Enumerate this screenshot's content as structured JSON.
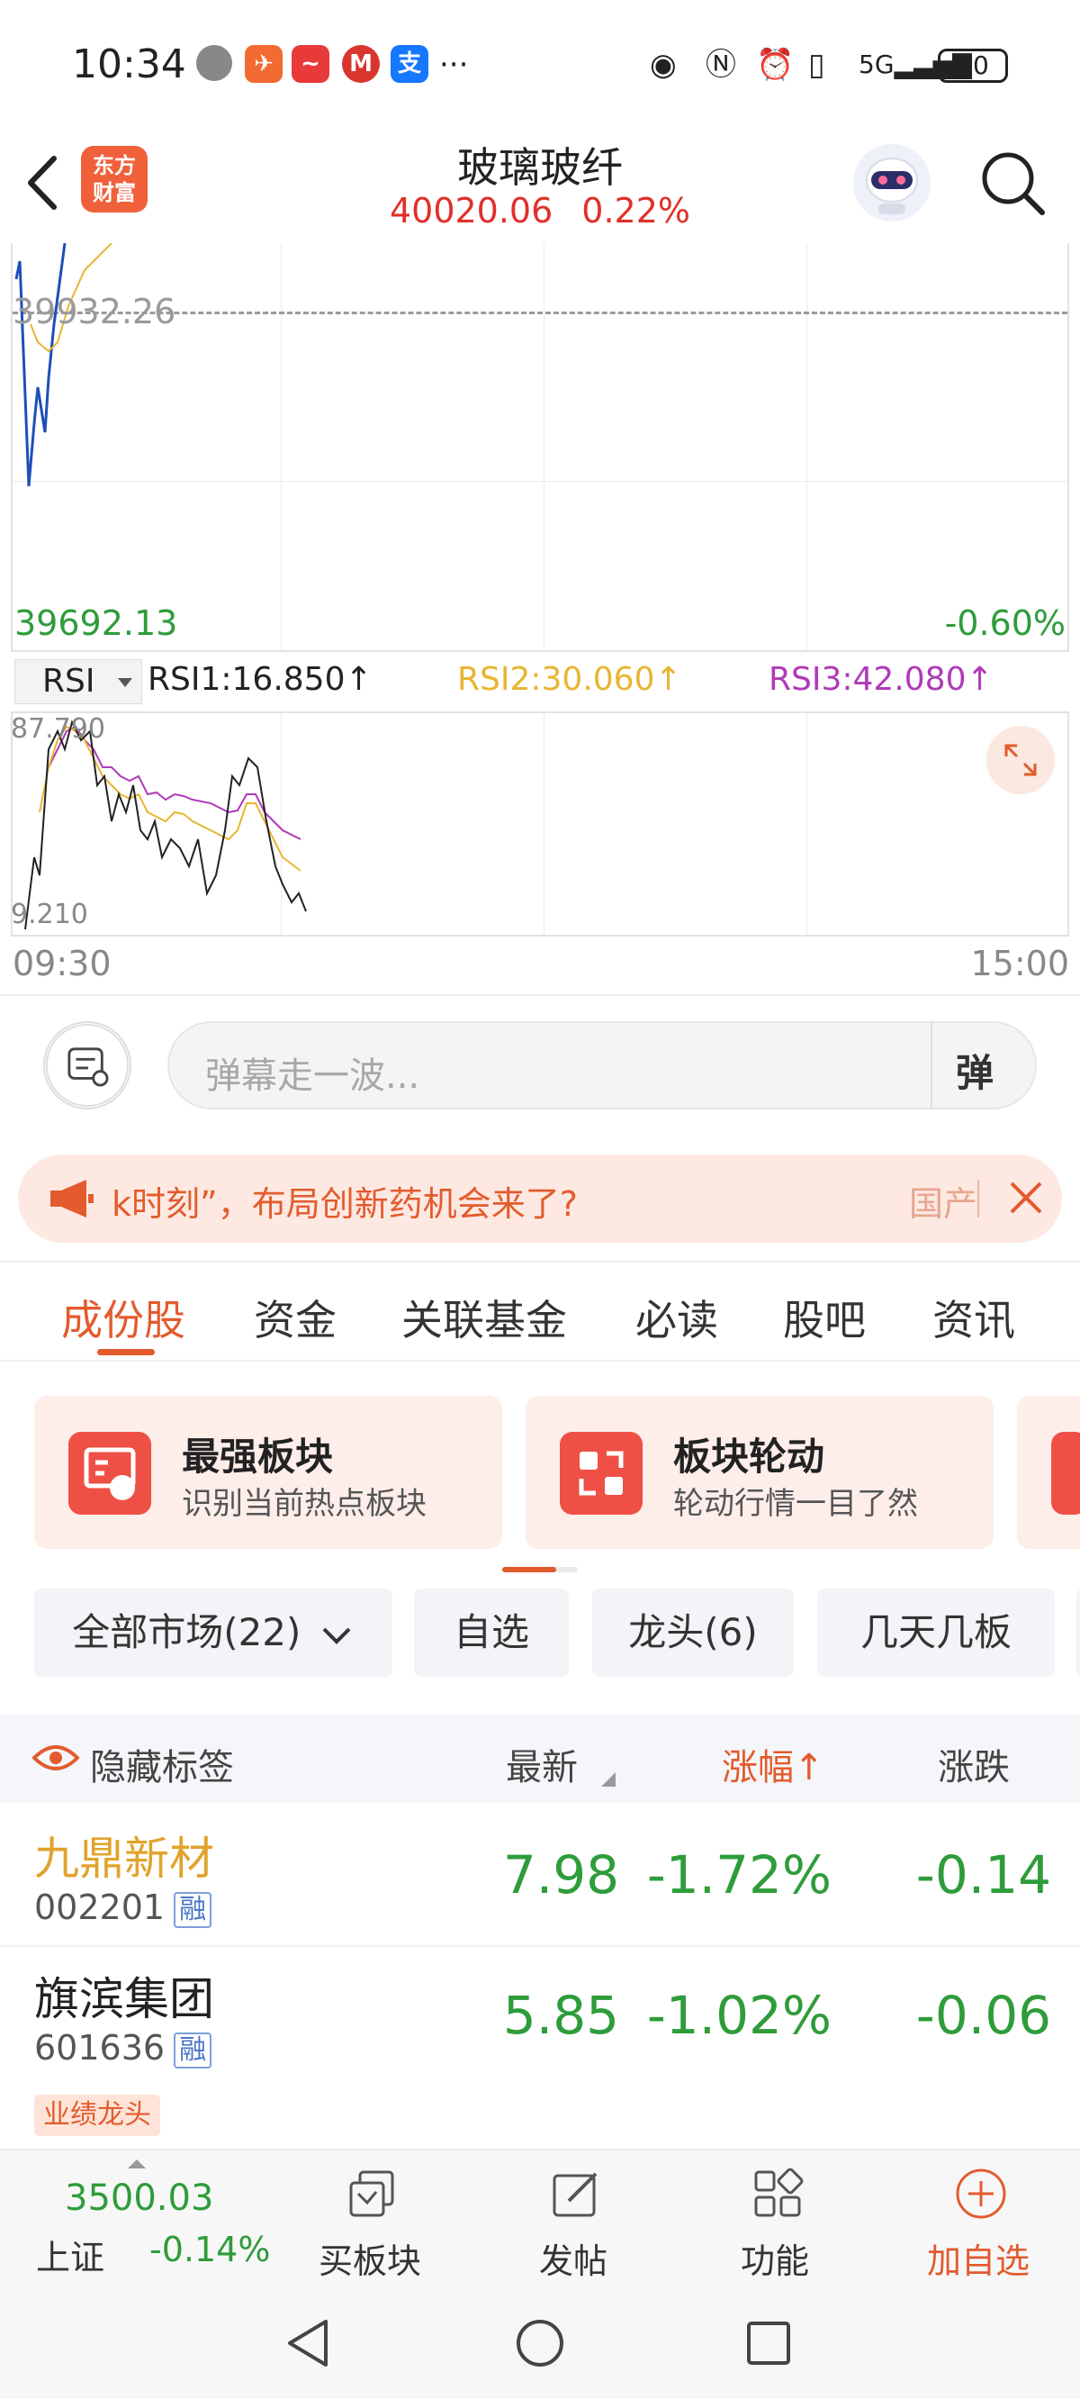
{
  "status_bar": {
    "time": "10:34",
    "battery": "70"
  },
  "header": {
    "title": "玻璃玻纤",
    "price": "40020.06",
    "change_pct": "0.22%",
    "logo_text_1": "东方",
    "logo_text_2": "财富"
  },
  "chart": {
    "prev_close_label": "39932.26",
    "low_label": "39692.13",
    "low_pct": "-0.60%"
  },
  "rsi": {
    "selector": "RSI",
    "rsi1": "RSI1:16.850↑",
    "rsi2": "RSI2:30.060↑",
    "rsi3": "RSI3:42.080↑",
    "max_label": "87.790",
    "min_label": "9.210",
    "colors": {
      "rsi1": "#222222",
      "rsi2": "#e8b531",
      "rsi3": "#b03ab8"
    }
  },
  "time_axis": {
    "start": "09:30",
    "end": "15:00"
  },
  "danmaku": {
    "placeholder": "弹幕走一波...",
    "send_label": "弹"
  },
  "banner": {
    "text": "k时刻”，布局创新药机会来了?",
    "source": "国产"
  },
  "tabs": [
    {
      "label": "成份股",
      "active": true
    },
    {
      "label": "资金"
    },
    {
      "label": "关联基金"
    },
    {
      "label": "必读"
    },
    {
      "label": "股吧"
    },
    {
      "label": "资讯"
    }
  ],
  "cards": [
    {
      "title": "最强板块",
      "subtitle": "识别当前热点板块"
    },
    {
      "title": "板块轮动",
      "subtitle": "轮动行情一目了然"
    }
  ],
  "filters": [
    "全部市场(22)",
    "自选",
    "龙头(6)",
    "几天几板"
  ],
  "table": {
    "hide_label": "隐藏标签",
    "col_latest": "最新",
    "col_pct": "涨幅↑",
    "col_chg": "涨跌",
    "rows": [
      {
        "name": "九鼎新材",
        "code": "002201",
        "badge": "融",
        "price": "7.98",
        "pct": "-1.72%",
        "chg": "-0.14",
        "tag": ""
      },
      {
        "name": "旗滨集团",
        "code": "601636",
        "badge": "融",
        "price": "5.85",
        "pct": "-1.02%",
        "chg": "-0.06",
        "tag": "业绩龙头"
      }
    ]
  },
  "bottom_bar": {
    "index_value": "3500.03",
    "index_name": "上证",
    "index_change": "-0.14%",
    "buttons": [
      "买板块",
      "发帖",
      "功能",
      "加自选"
    ]
  }
}
